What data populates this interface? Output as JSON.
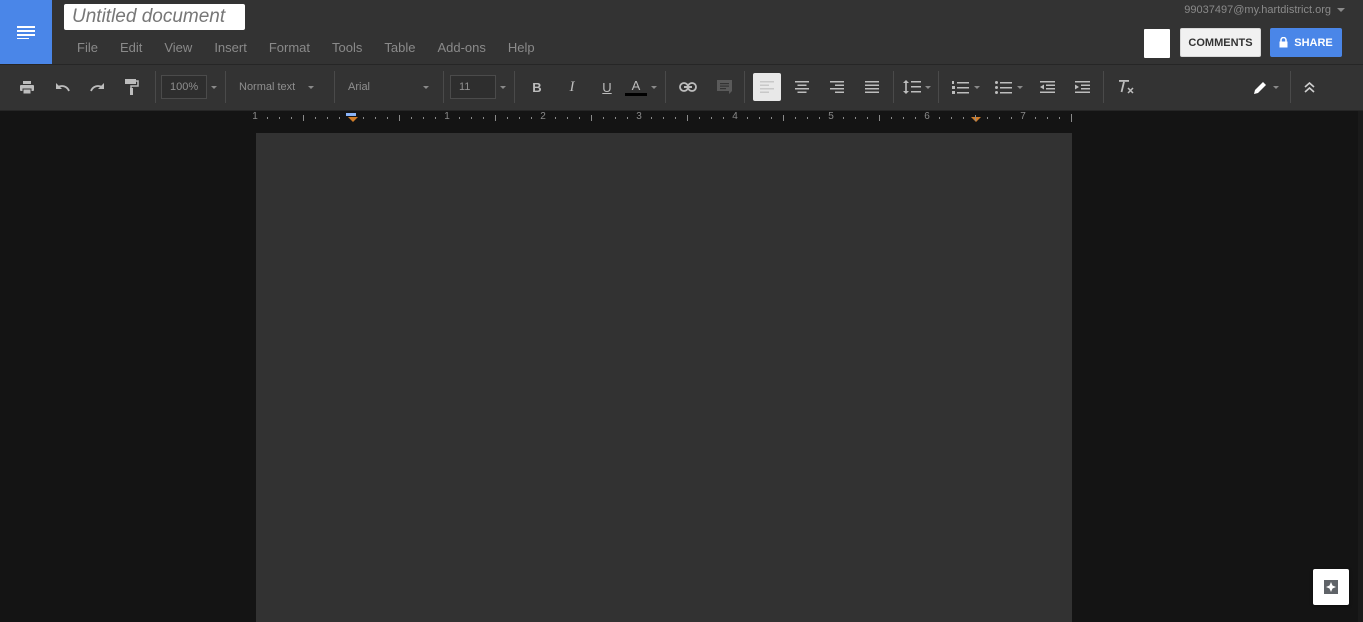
{
  "app": {
    "doc_title": "Untitled document",
    "account": "99037497@my.hartdistrict.org"
  },
  "menu": [
    "File",
    "Edit",
    "View",
    "Insert",
    "Format",
    "Tools",
    "Table",
    "Add-ons",
    "Help"
  ],
  "buttons": {
    "comments": "COMMENTS",
    "share": "SHARE"
  },
  "toolbar": {
    "zoom": "100%",
    "style": "Normal text",
    "font": "Arial",
    "size": "11",
    "bold": "B",
    "italic": "I",
    "underline": "U",
    "text_color_letter": "A",
    "text_color": "#000000",
    "active_alignment": "left"
  },
  "ruler": {
    "labels": [
      "1",
      "1",
      "2",
      "3",
      "4",
      "5",
      "6",
      "7"
    ]
  },
  "colors": {
    "accent": "#4a86e8",
    "chrome": "#333333",
    "page": "#323232",
    "background": "#141414"
  },
  "icons": [
    "docs-logo-icon",
    "print-icon",
    "undo-icon",
    "redo-icon",
    "paint-format-icon",
    "link-icon",
    "comment-icon",
    "align-left-icon",
    "align-center-icon",
    "align-right-icon",
    "justify-icon",
    "line-spacing-icon",
    "numbered-list-icon",
    "bulleted-list-icon",
    "decrease-indent-icon",
    "increase-indent-icon",
    "clear-formatting-icon",
    "pencil-icon",
    "collapse-icon",
    "lock-icon",
    "explore-icon"
  ]
}
